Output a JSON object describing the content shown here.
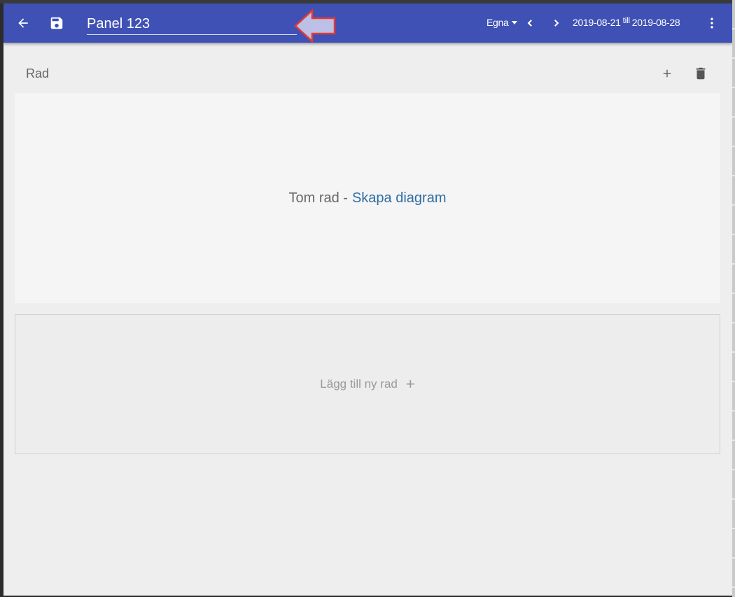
{
  "appbar": {
    "title_value": "Panel 123",
    "range_select": "Egna",
    "date_from": "2019-08-21",
    "date_sep": "till",
    "date_to": "2019-08-28",
    "bar_color": "#3f51b5"
  },
  "icons": {
    "back": "arrow-left-icon",
    "save": "floppy-disk-icon",
    "prev": "chevron-left-icon",
    "next": "chevron-right-icon",
    "more": "more-vert-icon",
    "add": "plus-icon",
    "delete": "trash-icon"
  },
  "row": {
    "label": "Rad",
    "empty_text": "Tom rad -",
    "create_link": "Skapa diagram"
  },
  "add_row": {
    "label": "Lägg till ny rad",
    "plus": "+"
  }
}
